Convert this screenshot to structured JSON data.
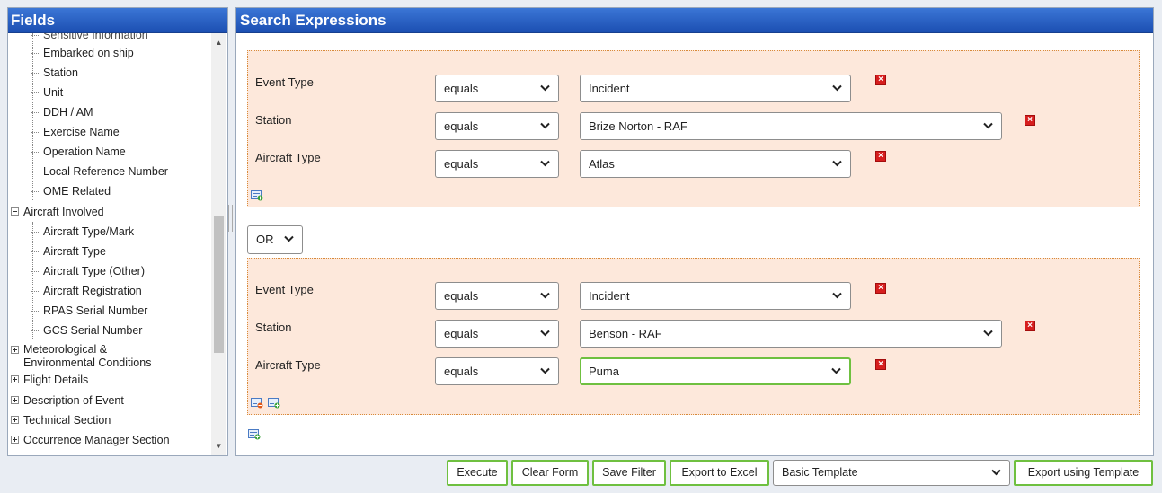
{
  "fields_panel": {
    "title": "Fields",
    "cut_off_item": "Sensitive Information",
    "items": [
      {
        "label": "Embarked on ship"
      },
      {
        "label": "Station"
      },
      {
        "label": "Unit"
      },
      {
        "label": "DDH / AM"
      },
      {
        "label": "Exercise Name"
      },
      {
        "label": "Operation Name"
      },
      {
        "label": "Local Reference Number"
      },
      {
        "label": "OME Related"
      }
    ],
    "aircraft_involved": {
      "label": "Aircraft Involved",
      "children": [
        {
          "label": "Aircraft Type/Mark"
        },
        {
          "label": "Aircraft Type"
        },
        {
          "label": "Aircraft Type (Other)"
        },
        {
          "label": "Aircraft Registration"
        },
        {
          "label": "RPAS Serial Number"
        },
        {
          "label": "GCS Serial Number"
        }
      ]
    },
    "collapsed_sections": [
      {
        "label": "Meteorological &\nEnvironmental Conditions"
      },
      {
        "label": "Flight Details"
      },
      {
        "label": "Description of Event"
      },
      {
        "label": "Technical Section"
      },
      {
        "label": "Occurrence Manager Section"
      }
    ]
  },
  "search_panel": {
    "title": "Search Expressions",
    "groups": [
      {
        "conditions": [
          {
            "field": "Event Type",
            "operator": "equals",
            "value": "Incident"
          },
          {
            "field": "Station",
            "operator": "equals",
            "value": "Brize Norton - RAF"
          },
          {
            "field": "Aircraft Type",
            "operator": "equals",
            "value": "Atlas"
          }
        ]
      },
      {
        "conditions": [
          {
            "field": "Event Type",
            "operator": "equals",
            "value": "Incident"
          },
          {
            "field": "Station",
            "operator": "equals",
            "value": "Benson - RAF"
          },
          {
            "field": "Aircraft Type",
            "operator": "equals",
            "value": "Puma"
          }
        ]
      }
    ],
    "join_operator": "OR"
  },
  "toolbar": {
    "execute": "Execute",
    "clear_form": "Clear Form",
    "save_filter": "Save Filter",
    "export_excel": "Export to Excel",
    "template_value": "Basic Template",
    "export_template": "Export using Template"
  },
  "colors": {
    "header_blue": "#1c4fb2",
    "group_bg": "#fde8db",
    "accent_green": "#6fc040",
    "remove_red": "#d61e1e"
  }
}
